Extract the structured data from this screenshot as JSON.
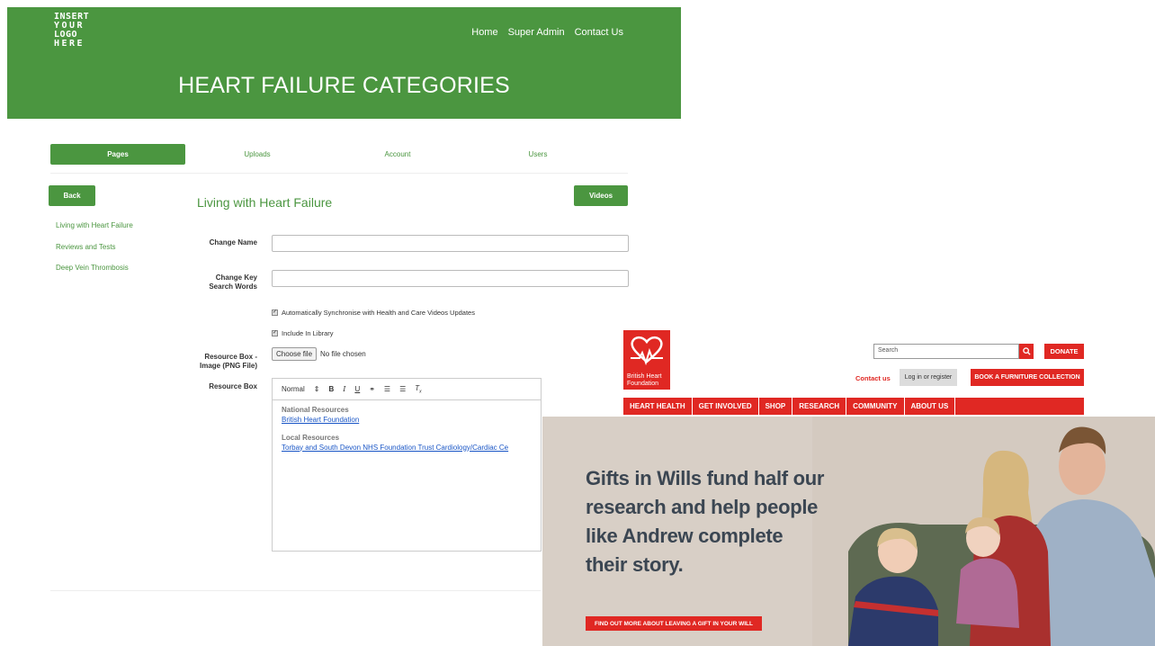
{
  "admin": {
    "logo_lines": [
      "INSERT",
      "YOUR",
      "LOGO",
      "HERE"
    ],
    "top_nav": [
      "Home",
      "Super Admin",
      "Contact Us"
    ],
    "title": "HEART FAILURE CATEGORIES",
    "tabs": [
      "Pages",
      "Uploads",
      "Account",
      "Users"
    ],
    "back_label": "Back",
    "videos_label": "Videos",
    "sidebar": [
      "Living with Heart Failure",
      "Reviews and Tests",
      "Deep Vein Thrombosis"
    ],
    "page_heading": "Living with Heart Failure",
    "form": {
      "change_name_label": "Change Name",
      "change_name_value": "",
      "change_key_label": "Change Key Search Words",
      "change_key_value": "",
      "checkbox_sync_label": "Automatically Synchronise with Health and Care Videos Updates",
      "checkbox_sync_checked": "✓",
      "checkbox_library_label": "Include In Library",
      "checkbox_library_checked": "✓",
      "resource_image_label": "Resource Box - Image (PNG File)",
      "choose_file_label": "Choose file",
      "no_file_text": "No file chosen",
      "resource_box_label": "Resource Box"
    },
    "editor": {
      "format_select": "Normal",
      "toolbar_icons": [
        "select-arrows",
        "bold",
        "italic",
        "underline",
        "link",
        "ordered-list",
        "bullet-list",
        "clear-format"
      ],
      "national_heading": "National Resources",
      "national_link": "British Heart Foundation",
      "local_heading": "Local Resources",
      "local_link": "Torbay and South Devon NHS Foundation Trust Cardiology/Cardiac Ce"
    },
    "colors": {
      "brand_green": "#4b9640",
      "link_blue": "#1a56c6"
    }
  },
  "bhf": {
    "logo_text": [
      "British Heart",
      "Foundation"
    ],
    "search_placeholder": "Search",
    "donate_label": "DONATE",
    "contact_label": "Contact us",
    "login_label": "Log in or register",
    "furniture_label": "BOOK A FURNITURE COLLECTION",
    "nav": [
      "HEART HEALTH",
      "GET INVOLVED",
      "SHOP",
      "RESEARCH",
      "COMMUNITY",
      "ABOUT US"
    ],
    "hero_lines": [
      "Gifts in Wills fund half our",
      "research and help people",
      "like Andrew complete",
      "their story."
    ],
    "hero_cta": "FIND OUT MORE ABOUT LEAVING A GIFT IN YOUR WILL",
    "colors": {
      "brand_red": "#e02823",
      "hero_text": "#3b4652"
    }
  }
}
